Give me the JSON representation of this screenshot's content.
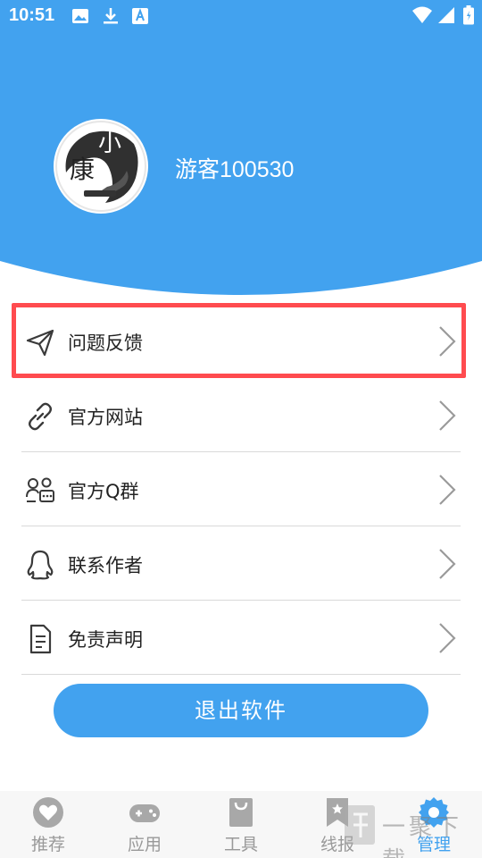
{
  "colors": {
    "primary": "#42a2ef",
    "highlight": "#ff4b4f",
    "tab_inactive": "#999999"
  },
  "status_bar": {
    "time": "10:51",
    "left_icons": [
      "image-icon",
      "download-icon",
      "font-icon"
    ],
    "right_icons": [
      "wifi-icon",
      "signal-icon",
      "battery-icon"
    ]
  },
  "profile": {
    "avatar_text": {
      "line1": "小",
      "line2": "康"
    },
    "username": "游客100530"
  },
  "menu": [
    {
      "label": "问题反馈",
      "icon": "send-icon"
    },
    {
      "label": "官方网站",
      "icon": "link-icon"
    },
    {
      "label": "官方Q群",
      "icon": "group-icon"
    },
    {
      "label": "联系作者",
      "icon": "qq-icon"
    },
    {
      "label": "免责声明",
      "icon": "document-icon"
    }
  ],
  "logout_label": "退出软件",
  "tabs": [
    {
      "label": "推荐",
      "icon": "heart-icon",
      "active": false
    },
    {
      "label": "应用",
      "icon": "gamepad-icon",
      "active": false
    },
    {
      "label": "工具",
      "icon": "bag-icon",
      "active": false
    },
    {
      "label": "线报",
      "icon": "bookmark-icon",
      "active": false
    },
    {
      "label": "管理",
      "icon": "gear-icon",
      "active": true
    }
  ],
  "watermark": {
    "text": "一聚下载"
  }
}
